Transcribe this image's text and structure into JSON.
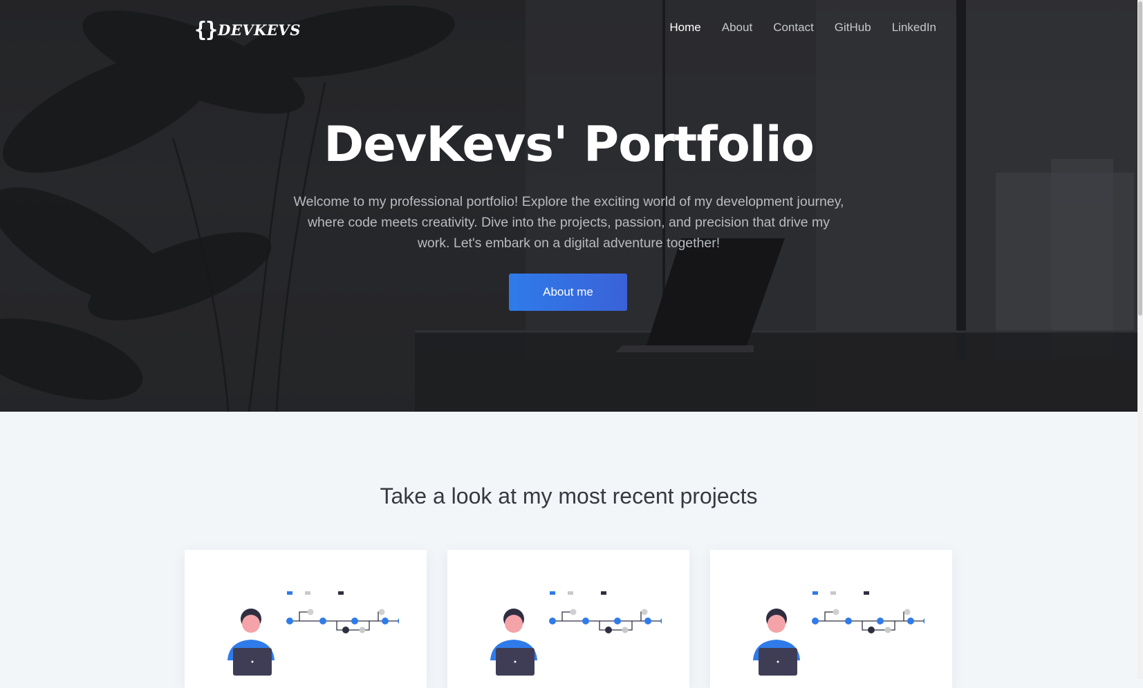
{
  "logo": {
    "brace": "{}",
    "text": "DEVKEVS"
  },
  "nav": {
    "items": [
      {
        "label": "Home"
      },
      {
        "label": "About"
      },
      {
        "label": "Contact"
      },
      {
        "label": "GitHub"
      },
      {
        "label": "LinkedIn"
      }
    ],
    "active": "Home"
  },
  "hero": {
    "title": "DevKevs' Portfolio",
    "subtitle": "Welcome to my professional portfolio! Explore the exciting world of my development journey, where code meets creativity. Dive into the projects, passion, and precision that drive my work. Let's embark on a digital adventure together!",
    "button_label": "About me"
  },
  "projects": {
    "heading": "Take a look at my most recent projects",
    "cards": [
      {
        "illustration": "developer-git-graph-illustration"
      },
      {
        "illustration": "developer-git-graph-illustration"
      },
      {
        "illustration": "developer-git-graph-illustration"
      }
    ]
  },
  "colors": {
    "accent": "#2f7bea",
    "accent_end": "#3a62d8",
    "hero_text": "#ffffff",
    "page_bg": "#f3f6f9",
    "heading": "#36393f"
  }
}
